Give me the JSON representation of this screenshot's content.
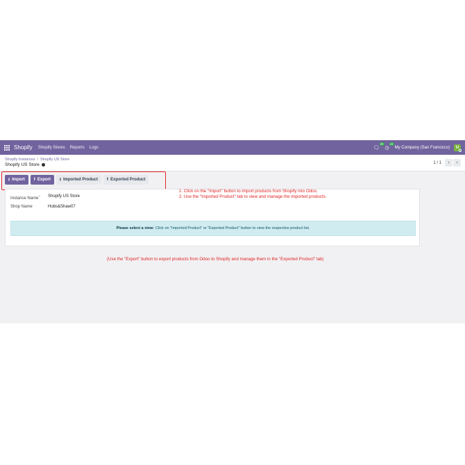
{
  "navbar": {
    "brand": "Shopify",
    "menu": [
      "Shopify Stores",
      "Reports",
      "Logs"
    ],
    "messages_count": "29",
    "activity_count": "24",
    "company": "My Company (San Francisco)",
    "avatar_letter": "M"
  },
  "breadcrumb": {
    "items": [
      "Shopify Instances",
      "Shopify US Store"
    ],
    "separator": "/",
    "current": "Shopify US Store"
  },
  "pager": {
    "text": "1 / 1",
    "prev": "‹",
    "next": "›"
  },
  "buttons": {
    "import": "Import",
    "export": "Export",
    "imported_product": "Imported Product",
    "exported_product": "Exported Product"
  },
  "form": {
    "instance_name_label": "Instance Name",
    "instance_name_help": "?",
    "instance_name_value": "Shopify US Store",
    "shop_name_label": "Shop Name",
    "shop_name_value": "Hobs&Shaw07"
  },
  "alert": {
    "strong": "Please select a view:",
    "text": "Click on \"Imported Product\" or \"Exported Product\" button to view the respective product list."
  },
  "annotations": {
    "line1": "1. Click on the \"Import\" button to import products from Shopify into Odoo.",
    "line2": "2. Use the \"Imported Product\" tab to view and manage the imported products.",
    "bottom": "(Use the \"Export\" button to export products from Odoo to Shopify and manage them in the \"Exported Product\" tab)"
  },
  "colors": {
    "brand": "#71639e",
    "annotation": "#e02424",
    "alert_bg": "#d1ecf1"
  }
}
